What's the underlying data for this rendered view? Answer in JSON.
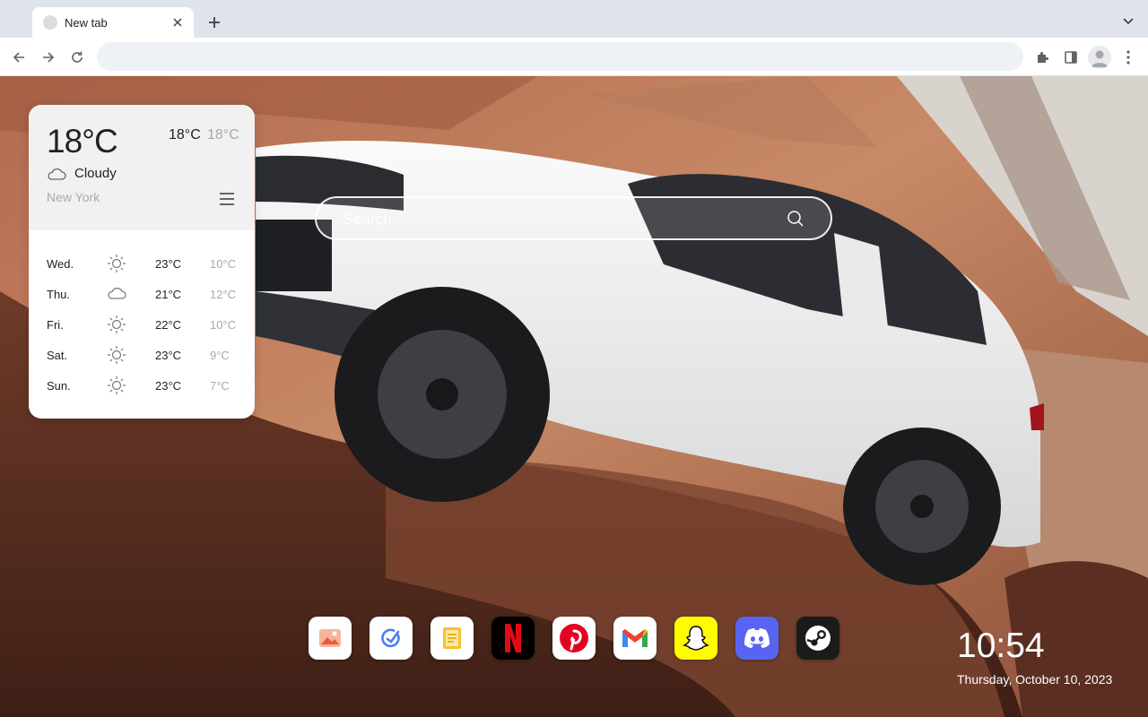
{
  "browser": {
    "tab": {
      "title": "New tab"
    },
    "omnibox": {
      "value": "",
      "placeholder": ""
    }
  },
  "weather": {
    "current_temp": "18°C",
    "high": "18°C",
    "low": "18°C",
    "condition": "Cloudy",
    "condition_icon": "cloud-icon",
    "city": "New York",
    "forecast": [
      {
        "day": "Wed.",
        "icon": "sun-icon",
        "high": "23°C",
        "low": "10°C"
      },
      {
        "day": "Thu.",
        "icon": "cloud-icon",
        "high": "21°C",
        "low": "12°C"
      },
      {
        "day": "Fri.",
        "icon": "sun-icon",
        "high": "22°C",
        "low": "10°C"
      },
      {
        "day": "Sat.",
        "icon": "sun-icon",
        "high": "23°C",
        "low": "9°C"
      },
      {
        "day": "Sun.",
        "icon": "sun-icon",
        "high": "23°C",
        "low": "7°C"
      }
    ]
  },
  "search": {
    "placeholder": "Search"
  },
  "dock": {
    "apps": [
      {
        "name": "photos",
        "color": "#ffffff"
      },
      {
        "name": "tasks",
        "color": "#ffffff"
      },
      {
        "name": "notes",
        "color": "#ffffff"
      },
      {
        "name": "netflix",
        "color": "#000000"
      },
      {
        "name": "pinterest",
        "color": "#ffffff"
      },
      {
        "name": "gmail",
        "color": "#ffffff"
      },
      {
        "name": "snapchat",
        "color": "#fffc00"
      },
      {
        "name": "discord",
        "color": "#5865f2"
      },
      {
        "name": "steam",
        "color": "#1b1b1b"
      }
    ]
  },
  "clock": {
    "time": "10:54",
    "date": "Thursday, October 10, 2023"
  }
}
